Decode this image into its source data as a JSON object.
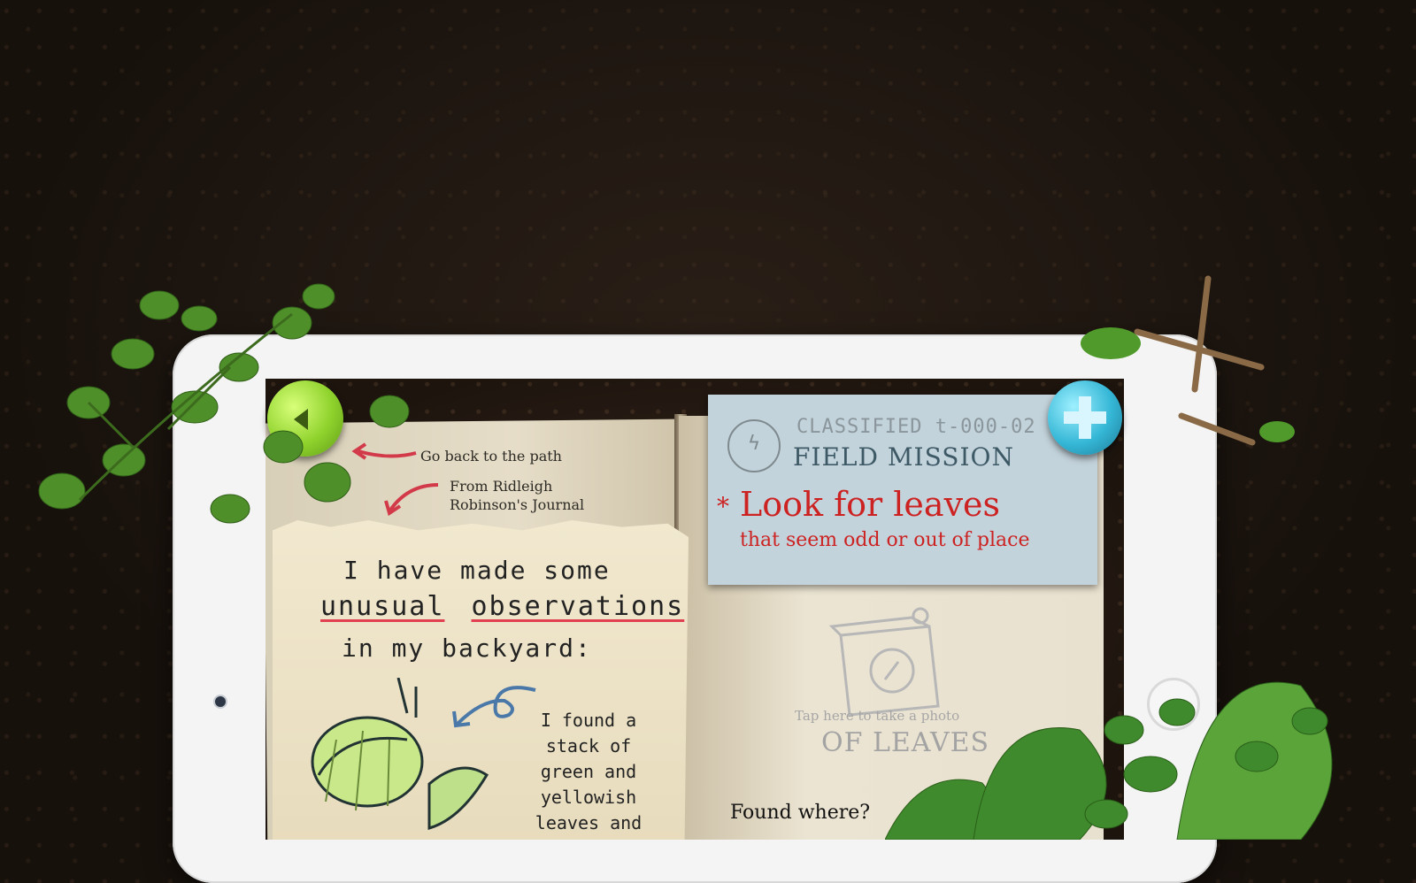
{
  "nav": {
    "back_label": "Go back to the path",
    "journal_line1": "From Ridleigh",
    "journal_line2": "Robinson's Journal"
  },
  "journal": {
    "line1": "I have made some",
    "line2_a": "unusual",
    "line2_b": "observations",
    "line3": "in my backyard:",
    "note_lines": [
      "I found a",
      "stack of",
      "green and",
      "yellowish",
      "leaves and"
    ]
  },
  "mission": {
    "classified": "CLASSIFIED t-000-02",
    "title": "FIELD MISSION",
    "star": "*",
    "main": "Look for leaves",
    "sub": "that seem odd or out of place"
  },
  "photo": {
    "hint": "Tap here to take a photo",
    "label": "OF LEAVES"
  },
  "found_where": "Found where?",
  "colors": {
    "accent_red": "#cc2222",
    "button_green": "#8fd22c",
    "button_blue": "#35b7d6",
    "card_blue": "#c3d3db"
  },
  "icons": {
    "left_button": "triangle-button-icon",
    "right_button": "plus-button-icon",
    "camera": "camera-sketch-icon"
  }
}
